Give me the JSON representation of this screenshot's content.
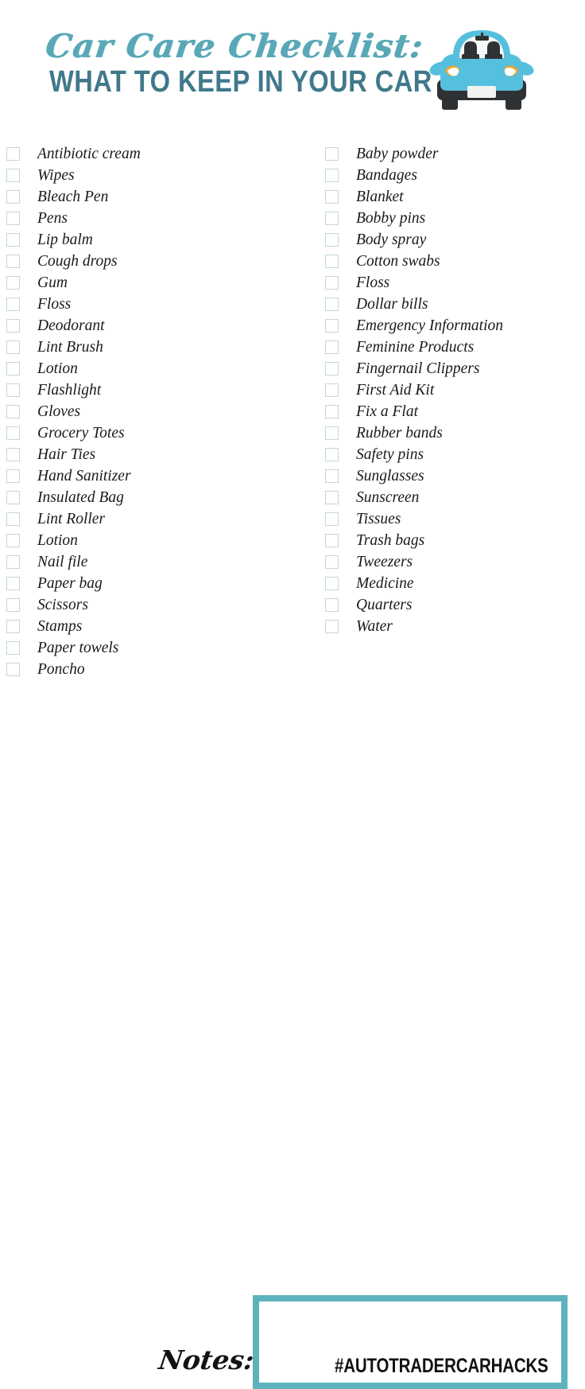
{
  "header": {
    "title_script": "Car Care Checklist:",
    "title_sub": "WHAT TO KEEP IN YOUR CAR",
    "illustration": "car-front-icon"
  },
  "colors": {
    "script_teal": "#59A8B7",
    "subtitle_teal": "#40798B",
    "box_border_teal": "#5CB3BE",
    "checkbox_outline": "#C3D7DD",
    "car_body_blue": "#55C0DE",
    "car_dark": "#2F3234",
    "car_headlight_orange": "#F5A623",
    "text_black": "#1a1a1a",
    "page_background": "#ffffff"
  },
  "checklist": {
    "column_left": [
      "Antibiotic cream",
      "Wipes",
      "Bleach Pen",
      "Pens",
      "Lip balm",
      "Cough drops",
      "Gum",
      "Floss",
      "Deodorant",
      "Lint Brush",
      "Lotion",
      "Flashlight",
      "Gloves",
      "Grocery Totes",
      "Hair Ties",
      "Hand Sanitizer",
      "Insulated Bag",
      "Lint Roller",
      "Lotion",
      "Nail file",
      "Paper bag",
      "Scissors",
      "Stamps",
      "Paper towels",
      "Poncho"
    ],
    "column_right": [
      "Baby powder",
      "Bandages",
      "Blanket",
      "Bobby pins",
      "Body spray",
      "Cotton swabs",
      "Floss",
      "Dollar bills",
      "Emergency Information",
      "Feminine Products",
      "Fingernail Clippers",
      "First Aid Kit",
      "Fix a Flat",
      "Rubber bands",
      "Safety pins",
      "Sunglasses",
      "Sunscreen",
      "Tissues",
      "Trash bags",
      "Tweezers",
      "Medicine",
      "Quarters",
      "Water"
    ]
  },
  "footer": {
    "notes_label": "Notes:",
    "notes_value": "",
    "hashtag": "#AUTOTRADERCARHACKS"
  }
}
